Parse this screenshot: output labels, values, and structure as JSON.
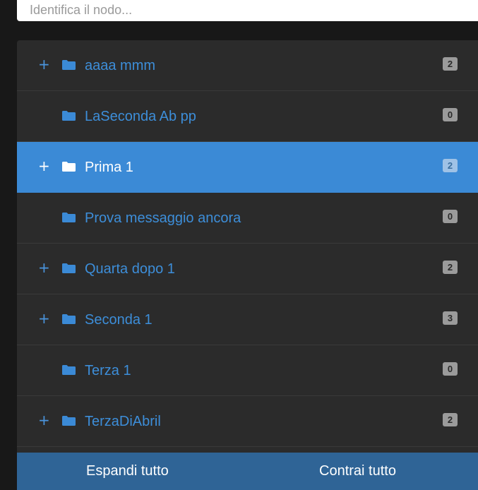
{
  "search": {
    "placeholder": "Identifica il nodo..."
  },
  "tree": {
    "nodes": [
      {
        "label": "aaaa mmm",
        "count": "2",
        "expandable": true,
        "active": false
      },
      {
        "label": "LaSeconda Ab pp",
        "count": "0",
        "expandable": false,
        "active": false
      },
      {
        "label": "Prima 1",
        "count": "2",
        "expandable": true,
        "active": true
      },
      {
        "label": "Prova messaggio ancora",
        "count": "0",
        "expandable": false,
        "active": false
      },
      {
        "label": "Quarta dopo 1",
        "count": "2",
        "expandable": true,
        "active": false
      },
      {
        "label": "Seconda 1",
        "count": "3",
        "expandable": true,
        "active": false
      },
      {
        "label": "Terza 1",
        "count": "0",
        "expandable": false,
        "active": false
      },
      {
        "label": "TerzaDiAbril",
        "count": "2",
        "expandable": true,
        "active": false
      }
    ],
    "expander_glyph": "+",
    "icon": "folder-icon"
  },
  "footer": {
    "expand_all_label": "Espandi tutto",
    "collapse_all_label": "Contrai tutto"
  },
  "colors": {
    "accent": "#3b8ad6",
    "footer": "#2f6496",
    "panel": "#2b2b2b",
    "background": "#181818"
  }
}
